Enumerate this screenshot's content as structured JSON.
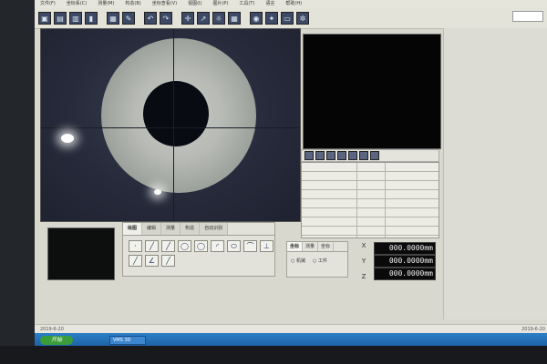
{
  "menu": {
    "items": [
      "文件(F)",
      "坐标系(C)",
      "测量(M)",
      "构造(B)",
      "坐标查看(V)",
      "视图(I)",
      "图片(P)",
      "工具(T)",
      "语言",
      "帮助(H)"
    ]
  },
  "toolbar": {
    "icons": [
      "open-icon",
      "save-icon",
      "print-icon",
      "chart-icon",
      "grid-icon",
      "settings-icon",
      "undo-icon",
      "redo-icon",
      "crosshair-icon",
      "probe-icon",
      "light-icon",
      "table-icon",
      "camera-icon",
      "bulb-icon",
      "image-icon",
      "gear-icon"
    ]
  },
  "tool_panel": {
    "tabs": [
      "绘图",
      "编辑",
      "测量",
      "构造",
      "自动识别"
    ],
    "active_tab": "绘图",
    "tools": [
      "·",
      "╱",
      "╱",
      "◯",
      "◯",
      "◜",
      "⬭",
      "⌒",
      "⊥",
      "╱",
      "∠",
      "╱"
    ]
  },
  "coord_panel": {
    "tabs": [
      "坐标",
      "测量",
      "坐标"
    ],
    "radio_options": [
      "机械",
      "工件"
    ]
  },
  "axes": {
    "x_label": "X",
    "y_label": "Y",
    "z_label": "Z"
  },
  "readouts": {
    "x_value": "000.0000mm",
    "y_value": "000.0000mm",
    "z_value": "000.0000mm"
  },
  "status": {
    "left": "2019-6-20",
    "right": "2019-6-20"
  },
  "taskbar": {
    "start_label": "开始",
    "task_label": "VMS 3D"
  }
}
